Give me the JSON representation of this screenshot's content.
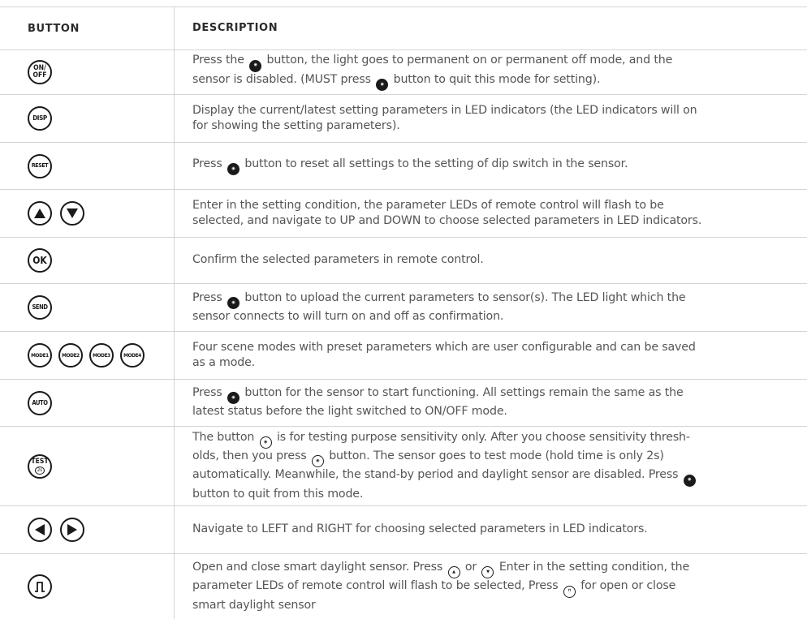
{
  "header": {
    "button": "BUTTON",
    "description": "DESCRIPTION"
  },
  "rows": [
    {
      "icons": [
        "on-off"
      ],
      "icon_text": [
        "ON/",
        "OFF"
      ],
      "lines": [
        "Press the [on-off] button, the light goes to permanent on or permanent off mode, and the",
        "sensor is disabled. (MUST press [auto] button to quit this mode for setting)."
      ],
      "l1a": "Press the",
      "l1b": "button, the light goes to permanent on or permanent off mode, and the",
      "l2a": "sensor is disabled. (MUST press",
      "l2b": "button to quit this mode for setting)."
    },
    {
      "icon_text": "DISP",
      "l1": "Display the current/latest setting parameters in LED indicators (the LED indicators will on",
      "l2": "for showing the setting parameters)."
    },
    {
      "icon_text": "RESET",
      "l1a": "Press",
      "l1b": "button to reset all settings to the setting of dip switch in the sensor."
    },
    {
      "icons": [
        "up-arrow",
        "down-arrow"
      ],
      "l1": "Enter in the setting condition, the parameter LEDs of remote control will flash to be",
      "l2": "selected, and navigate to UP and DOWN to choose selected parameters in LED indicators."
    },
    {
      "icon_text": "OK",
      "l1": "Confirm the selected parameters in remote control."
    },
    {
      "icon_text": "SEND",
      "l1a": "Press",
      "l1b": "button to upload the current parameters to sensor(s). The LED light which the",
      "l2": "sensor connects to will turn on and off as confirmation."
    },
    {
      "icon_texts": [
        "MODE1",
        "MODE2",
        "MODE3",
        "MODE4"
      ],
      "l1": "Four scene modes with preset parameters which are user configurable and can be saved",
      "l2": "as a mode."
    },
    {
      "icon_text": "AUTO",
      "l1a": "Press",
      "l1b": "button for the sensor to start functioning. All settings remain the same as the",
      "l2": "latest status before the light switched to ON/OFF mode."
    },
    {
      "icon_text": [
        "TEST",
        "2s"
      ],
      "l1a": "The button",
      "l1b": "is for testing purpose sensitivity only. After you choose sensitivity thresh-",
      "l2a": "olds, then you press",
      "l2b": "button. The sensor goes to test mode (hold time is only 2s)",
      "l3a": "automatically. Meanwhile, the stand-by period and daylight sensor are disabled. Press",
      "l4": "button to quit from this mode."
    },
    {
      "icons": [
        "left-arrow",
        "right-arrow"
      ],
      "l1": "Navigate to LEFT and RIGHT for choosing selected parameters in LED indicators."
    },
    {
      "icons": [
        "daylight-sensor"
      ],
      "l1a": "Open and close smart daylight sensor. Press",
      "l1b": "or",
      "l1c": "Enter in the setting condition, the",
      "l2a": "parameter LEDs of remote control will flash to be selected, Press",
      "l2b": "for open or close",
      "l3": "smart daylight sensor"
    }
  ],
  "mini_labels": {
    "on_off": "ON/OFF",
    "auto": "AUTO",
    "reset": "RESET",
    "send": "SEND",
    "test": "TEST"
  }
}
